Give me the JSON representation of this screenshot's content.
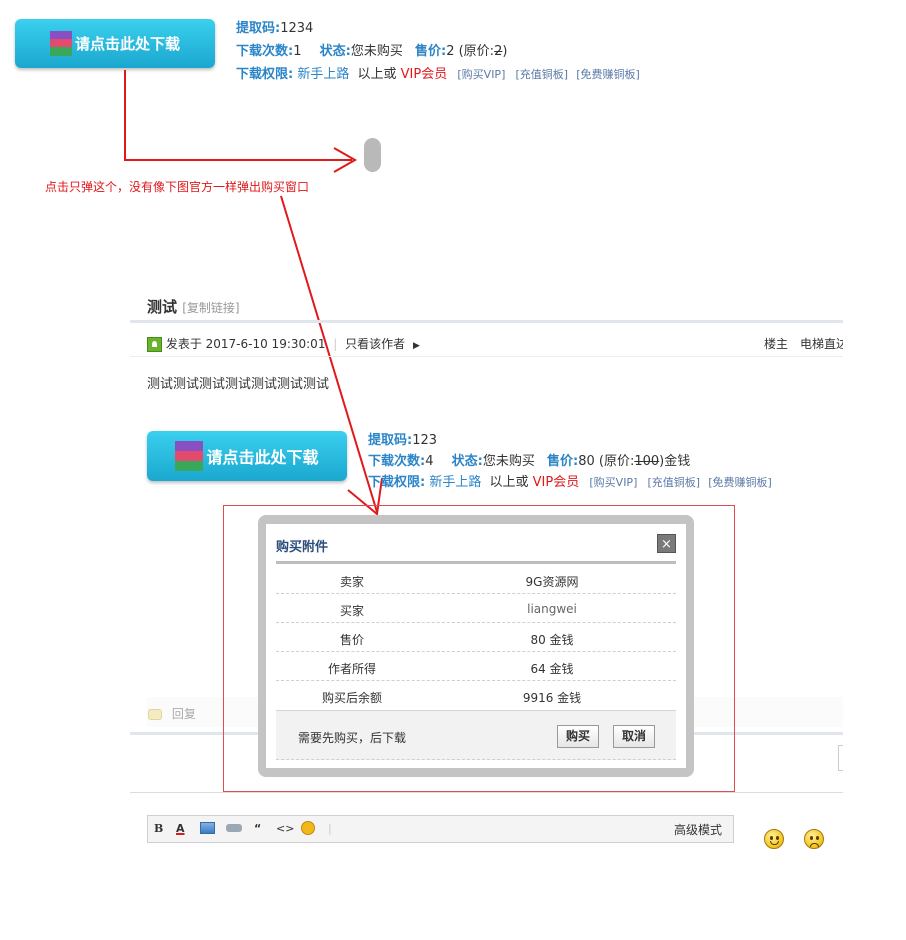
{
  "top": {
    "download_button": "请点击此处下载",
    "code_label": "提取码:",
    "code_value": "1234",
    "downloads_label": "下载次数:",
    "downloads_value": "1",
    "status_label": "状态:",
    "status_value": "您未购买",
    "price_label": "售价:",
    "price_value": "2",
    "orig_open": "(原价:",
    "orig_value": "2",
    "orig_close": ")",
    "perm_label": "下载权限:",
    "perm_group": "新手上路",
    "perm_mid": "以上或",
    "perm_vip": "VIP会员",
    "buy_vip": "[购买VIP]",
    "recharge": "[充值铜板]",
    "earn": "[免费赚铜板]"
  },
  "annotation": "点击只弹这个，没有像下图官方一样弹出购买窗口",
  "post": {
    "title": "测试",
    "copy_link": "[复制链接]",
    "posted_at": "发表于 2017-6-10 19:30:01",
    "only_author": "只看该作者",
    "owner": "楼主",
    "elevator": "电梯直达",
    "body": "测试测试测试测试测试测试测试"
  },
  "attach": {
    "download_button": "请点击此处下载",
    "code_label": "提取码:",
    "code_value": "123",
    "downloads_label": "下载次数:",
    "downloads_value": "4",
    "status_label": "状态:",
    "status_value": "您未购买",
    "price_label": "售价:",
    "price_value": "80",
    "orig_open": "(原价:",
    "orig_value": "100",
    "orig_close": ")金钱",
    "perm_label": "下载权限:",
    "perm_group": "新手上路",
    "perm_mid": "以上或",
    "perm_vip": "VIP会员",
    "buy_vip": "[购买VIP]",
    "recharge": "[充值铜板]",
    "earn": "[免费赚铜板]"
  },
  "modal": {
    "title": "购买附件",
    "close": "×",
    "rows": [
      {
        "k": "卖家",
        "v": "9G资源网"
      },
      {
        "k": "买家",
        "v": "liangwei"
      },
      {
        "k": "售价",
        "v": "80 金钱"
      },
      {
        "k": "作者所得",
        "v": "64 金钱"
      },
      {
        "k": "购买后余额",
        "v": "9916 金钱"
      }
    ],
    "note": "需要先购买，后下载",
    "buy": "购买",
    "cancel": "取消"
  },
  "reply": "回复",
  "editor": {
    "bold": "B",
    "font_color": "A",
    "quote": "“",
    "code": "<>",
    "advanced": "高级模式"
  },
  "colors": {
    "accent_blue": "#2b85c8",
    "annotation_red": "#e0191b",
    "button_blue": "#1ba7cf"
  }
}
